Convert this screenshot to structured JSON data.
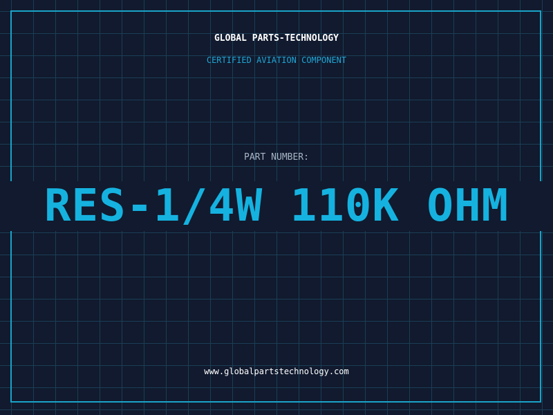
{
  "header": {
    "brand": "GLOBAL PARTS-TECHNOLOGY",
    "subtitle": "CERTIFIED AVIATION COMPONENT"
  },
  "part": {
    "label": "PART NUMBER:",
    "value": "RES-1/4W 110K OHM"
  },
  "footer": {
    "website": "www.globalpartstechnology.com"
  },
  "colors": {
    "background": "#111a2e",
    "grid": "#1b3e56",
    "frame": "#1aa3c8",
    "accent": "#15b2e0",
    "label": "#a9b6c7",
    "text": "#ffffff"
  }
}
